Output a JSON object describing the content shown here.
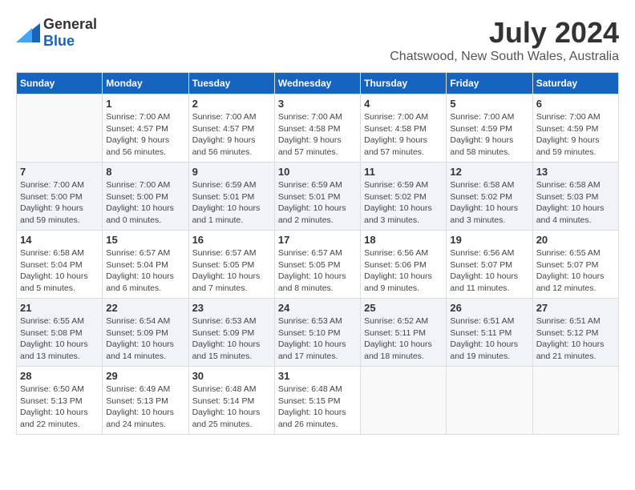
{
  "header": {
    "logo_general": "General",
    "logo_blue": "Blue",
    "title": "July 2024",
    "location": "Chatswood, New South Wales, Australia"
  },
  "days_of_week": [
    "Sunday",
    "Monday",
    "Tuesday",
    "Wednesday",
    "Thursday",
    "Friday",
    "Saturday"
  ],
  "weeks": [
    [
      null,
      {
        "day": 1,
        "sunrise": "7:00 AM",
        "sunset": "4:57 PM",
        "daylight": "9 hours and 56 minutes."
      },
      {
        "day": 2,
        "sunrise": "7:00 AM",
        "sunset": "4:57 PM",
        "daylight": "9 hours and 56 minutes."
      },
      {
        "day": 3,
        "sunrise": "7:00 AM",
        "sunset": "4:58 PM",
        "daylight": "9 hours and 57 minutes."
      },
      {
        "day": 4,
        "sunrise": "7:00 AM",
        "sunset": "4:58 PM",
        "daylight": "9 hours and 57 minutes."
      },
      {
        "day": 5,
        "sunrise": "7:00 AM",
        "sunset": "4:59 PM",
        "daylight": "9 hours and 58 minutes."
      },
      {
        "day": 6,
        "sunrise": "7:00 AM",
        "sunset": "4:59 PM",
        "daylight": "9 hours and 59 minutes."
      }
    ],
    [
      {
        "day": 7,
        "sunrise": "7:00 AM",
        "sunset": "5:00 PM",
        "daylight": "9 hours and 59 minutes."
      },
      {
        "day": 8,
        "sunrise": "7:00 AM",
        "sunset": "5:00 PM",
        "daylight": "10 hours and 0 minutes."
      },
      {
        "day": 9,
        "sunrise": "6:59 AM",
        "sunset": "5:01 PM",
        "daylight": "10 hours and 1 minute."
      },
      {
        "day": 10,
        "sunrise": "6:59 AM",
        "sunset": "5:01 PM",
        "daylight": "10 hours and 2 minutes."
      },
      {
        "day": 11,
        "sunrise": "6:59 AM",
        "sunset": "5:02 PM",
        "daylight": "10 hours and 3 minutes."
      },
      {
        "day": 12,
        "sunrise": "6:58 AM",
        "sunset": "5:02 PM",
        "daylight": "10 hours and 3 minutes."
      },
      {
        "day": 13,
        "sunrise": "6:58 AM",
        "sunset": "5:03 PM",
        "daylight": "10 hours and 4 minutes."
      }
    ],
    [
      {
        "day": 14,
        "sunrise": "6:58 AM",
        "sunset": "5:04 PM",
        "daylight": "10 hours and 5 minutes."
      },
      {
        "day": 15,
        "sunrise": "6:57 AM",
        "sunset": "5:04 PM",
        "daylight": "10 hours and 6 minutes."
      },
      {
        "day": 16,
        "sunrise": "6:57 AM",
        "sunset": "5:05 PM",
        "daylight": "10 hours and 7 minutes."
      },
      {
        "day": 17,
        "sunrise": "6:57 AM",
        "sunset": "5:05 PM",
        "daylight": "10 hours and 8 minutes."
      },
      {
        "day": 18,
        "sunrise": "6:56 AM",
        "sunset": "5:06 PM",
        "daylight": "10 hours and 9 minutes."
      },
      {
        "day": 19,
        "sunrise": "6:56 AM",
        "sunset": "5:07 PM",
        "daylight": "10 hours and 11 minutes."
      },
      {
        "day": 20,
        "sunrise": "6:55 AM",
        "sunset": "5:07 PM",
        "daylight": "10 hours and 12 minutes."
      }
    ],
    [
      {
        "day": 21,
        "sunrise": "6:55 AM",
        "sunset": "5:08 PM",
        "daylight": "10 hours and 13 minutes."
      },
      {
        "day": 22,
        "sunrise": "6:54 AM",
        "sunset": "5:09 PM",
        "daylight": "10 hours and 14 minutes."
      },
      {
        "day": 23,
        "sunrise": "6:53 AM",
        "sunset": "5:09 PM",
        "daylight": "10 hours and 15 minutes."
      },
      {
        "day": 24,
        "sunrise": "6:53 AM",
        "sunset": "5:10 PM",
        "daylight": "10 hours and 17 minutes."
      },
      {
        "day": 25,
        "sunrise": "6:52 AM",
        "sunset": "5:11 PM",
        "daylight": "10 hours and 18 minutes."
      },
      {
        "day": 26,
        "sunrise": "6:51 AM",
        "sunset": "5:11 PM",
        "daylight": "10 hours and 19 minutes."
      },
      {
        "day": 27,
        "sunrise": "6:51 AM",
        "sunset": "5:12 PM",
        "daylight": "10 hours and 21 minutes."
      }
    ],
    [
      {
        "day": 28,
        "sunrise": "6:50 AM",
        "sunset": "5:13 PM",
        "daylight": "10 hours and 22 minutes."
      },
      {
        "day": 29,
        "sunrise": "6:49 AM",
        "sunset": "5:13 PM",
        "daylight": "10 hours and 24 minutes."
      },
      {
        "day": 30,
        "sunrise": "6:48 AM",
        "sunset": "5:14 PM",
        "daylight": "10 hours and 25 minutes."
      },
      {
        "day": 31,
        "sunrise": "6:48 AM",
        "sunset": "5:15 PM",
        "daylight": "10 hours and 26 minutes."
      },
      null,
      null,
      null
    ]
  ]
}
